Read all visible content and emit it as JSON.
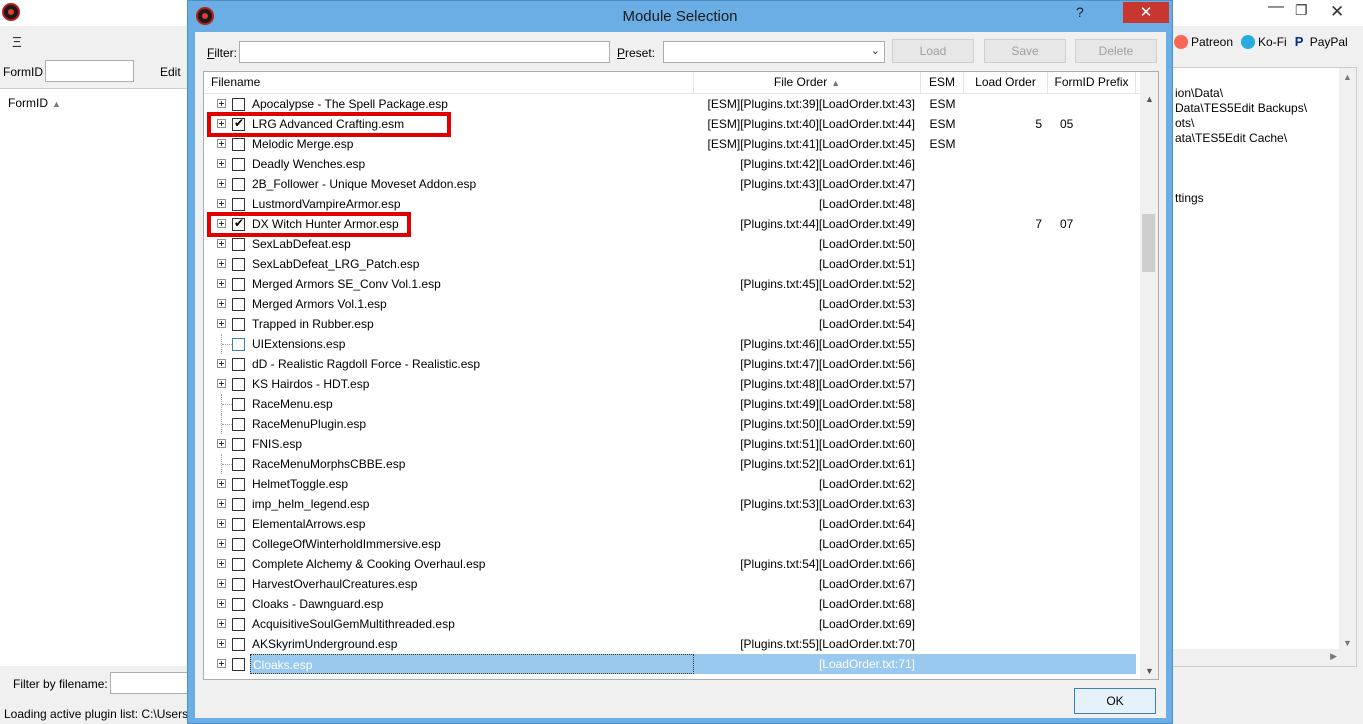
{
  "background_window": {
    "menu_icon": "Ξ",
    "formid_label": "FormID",
    "edit_label": "Edit",
    "left_header": "FormID",
    "filter_label": "Filter by filename:",
    "status_text": "Loading active plugin list: C:\\Users\\",
    "links": [
      {
        "icon": "patreon-icon",
        "label": "Patreon"
      },
      {
        "icon": "kofi-icon",
        "label": "Ko-Fi"
      },
      {
        "icon": "paypal-icon",
        "label": "PayPal"
      }
    ],
    "right_panel_lines": [
      "ion\\Data\\",
      "Data\\TES5Edit Backups\\",
      "ots\\",
      "ata\\TES5Edit Cache\\",
      "",
      "",
      "",
      "ttings"
    ]
  },
  "dialog": {
    "title": "Module Selection",
    "help_glyph": "?",
    "close_glyph": "✕",
    "filter_label_u": "F",
    "filter_label_rest": "ilter:",
    "filter_value": "",
    "preset_label_u": "P",
    "preset_label_rest": "reset:",
    "preset_value": "",
    "buttons": {
      "load": "Load",
      "save": "Save",
      "delete": "Delete",
      "ok": "OK"
    },
    "columns": {
      "filename": "Filename",
      "file_order": "File Order",
      "esm": "ESM",
      "load_order": "Load Order",
      "formid_prefix": "FormID Prefix"
    },
    "rows": [
      {
        "name": "Apocalypse - The Spell Package.esp",
        "order": "[ESM][Plugins.txt:39][LoadOrder.txt:43]",
        "esm": "ESM",
        "lo": "",
        "fp": "",
        "checked": false,
        "expander": true
      },
      {
        "name": "LRG Advanced Crafting.esm",
        "order": "[ESM][Plugins.txt:40][LoadOrder.txt:44]",
        "esm": "ESM",
        "lo": "5",
        "fp": "05",
        "checked": true,
        "expander": true
      },
      {
        "name": "Melodic Merge.esp",
        "order": "[ESM][Plugins.txt:41][LoadOrder.txt:45]",
        "esm": "ESM",
        "lo": "",
        "fp": "",
        "checked": false,
        "expander": true
      },
      {
        "name": "Deadly Wenches.esp",
        "order": "[Plugins.txt:42][LoadOrder.txt:46]",
        "esm": "",
        "lo": "",
        "fp": "",
        "checked": false,
        "expander": true
      },
      {
        "name": "2B_Follower - Unique Moveset Addon.esp",
        "order": "[Plugins.txt:43][LoadOrder.txt:47]",
        "esm": "",
        "lo": "",
        "fp": "",
        "checked": false,
        "expander": true
      },
      {
        "name": "LustmordVampireArmor.esp",
        "order": "[LoadOrder.txt:48]",
        "esm": "",
        "lo": "",
        "fp": "",
        "checked": false,
        "expander": true
      },
      {
        "name": "DX Witch Hunter Armor.esp",
        "order": "[Plugins.txt:44][LoadOrder.txt:49]",
        "esm": "",
        "lo": "7",
        "fp": "07",
        "checked": true,
        "expander": true
      },
      {
        "name": "SexLabDefeat.esp",
        "order": "[LoadOrder.txt:50]",
        "esm": "",
        "lo": "",
        "fp": "",
        "checked": false,
        "expander": true
      },
      {
        "name": "SexLabDefeat_LRG_Patch.esp",
        "order": "[LoadOrder.txt:51]",
        "esm": "",
        "lo": "",
        "fp": "",
        "checked": false,
        "expander": true
      },
      {
        "name": "Merged Armors SE_Conv Vol.1.esp",
        "order": "[Plugins.txt:45][LoadOrder.txt:52]",
        "esm": "",
        "lo": "",
        "fp": "",
        "checked": false,
        "expander": true
      },
      {
        "name": "Merged Armors Vol.1.esp",
        "order": "[LoadOrder.txt:53]",
        "esm": "",
        "lo": "",
        "fp": "",
        "checked": false,
        "expander": true
      },
      {
        "name": "Trapped in Rubber.esp",
        "order": "[LoadOrder.txt:54]",
        "esm": "",
        "lo": "",
        "fp": "",
        "checked": false,
        "expander": true
      },
      {
        "name": "UIExtensions.esp",
        "order": "[Plugins.txt:46][LoadOrder.txt:55]",
        "esm": "",
        "lo": "",
        "fp": "",
        "checked": false,
        "expander": false,
        "blue": true
      },
      {
        "name": "dD - Realistic Ragdoll Force - Realistic.esp",
        "order": "[Plugins.txt:47][LoadOrder.txt:56]",
        "esm": "",
        "lo": "",
        "fp": "",
        "checked": false,
        "expander": true
      },
      {
        "name": "KS Hairdos - HDT.esp",
        "order": "[Plugins.txt:48][LoadOrder.txt:57]",
        "esm": "",
        "lo": "",
        "fp": "",
        "checked": false,
        "expander": true
      },
      {
        "name": "RaceMenu.esp",
        "order": "[Plugins.txt:49][LoadOrder.txt:58]",
        "esm": "",
        "lo": "",
        "fp": "",
        "checked": false,
        "expander": false
      },
      {
        "name": "RaceMenuPlugin.esp",
        "order": "[Plugins.txt:50][LoadOrder.txt:59]",
        "esm": "",
        "lo": "",
        "fp": "",
        "checked": false,
        "expander": false
      },
      {
        "name": "FNIS.esp",
        "order": "[Plugins.txt:51][LoadOrder.txt:60]",
        "esm": "",
        "lo": "",
        "fp": "",
        "checked": false,
        "expander": true
      },
      {
        "name": "RaceMenuMorphsCBBE.esp",
        "order": "[Plugins.txt:52][LoadOrder.txt:61]",
        "esm": "",
        "lo": "",
        "fp": "",
        "checked": false,
        "expander": false
      },
      {
        "name": "HelmetToggle.esp",
        "order": "[LoadOrder.txt:62]",
        "esm": "",
        "lo": "",
        "fp": "",
        "checked": false,
        "expander": true
      },
      {
        "name": "imp_helm_legend.esp",
        "order": "[Plugins.txt:53][LoadOrder.txt:63]",
        "esm": "",
        "lo": "",
        "fp": "",
        "checked": false,
        "expander": true
      },
      {
        "name": "ElementalArrows.esp",
        "order": "[LoadOrder.txt:64]",
        "esm": "",
        "lo": "",
        "fp": "",
        "checked": false,
        "expander": true
      },
      {
        "name": "CollegeOfWinterholdImmersive.esp",
        "order": "[LoadOrder.txt:65]",
        "esm": "",
        "lo": "",
        "fp": "",
        "checked": false,
        "expander": true
      },
      {
        "name": "Complete Alchemy & Cooking Overhaul.esp",
        "order": "[Plugins.txt:54][LoadOrder.txt:66]",
        "esm": "",
        "lo": "",
        "fp": "",
        "checked": false,
        "expander": true
      },
      {
        "name": "HarvestOverhaulCreatures.esp",
        "order": "[LoadOrder.txt:67]",
        "esm": "",
        "lo": "",
        "fp": "",
        "checked": false,
        "expander": true
      },
      {
        "name": "Cloaks - Dawnguard.esp",
        "order": "[LoadOrder.txt:68]",
        "esm": "",
        "lo": "",
        "fp": "",
        "checked": false,
        "expander": true
      },
      {
        "name": "AcquisitiveSoulGemMultithreaded.esp",
        "order": "[LoadOrder.txt:69]",
        "esm": "",
        "lo": "",
        "fp": "",
        "checked": false,
        "expander": true
      },
      {
        "name": "AKSkyrimUnderground.esp",
        "order": "[Plugins.txt:55][LoadOrder.txt:70]",
        "esm": "",
        "lo": "",
        "fp": "",
        "checked": false,
        "expander": true
      },
      {
        "name": "Cloaks.esp",
        "order": "[LoadOrder.txt:71]",
        "esm": "",
        "lo": "",
        "fp": "",
        "checked": false,
        "expander": true,
        "selected": true
      }
    ],
    "highlighted_rows": [
      1,
      6
    ],
    "highlight_color": "#e00000",
    "selection_color": "#99c9ef"
  }
}
